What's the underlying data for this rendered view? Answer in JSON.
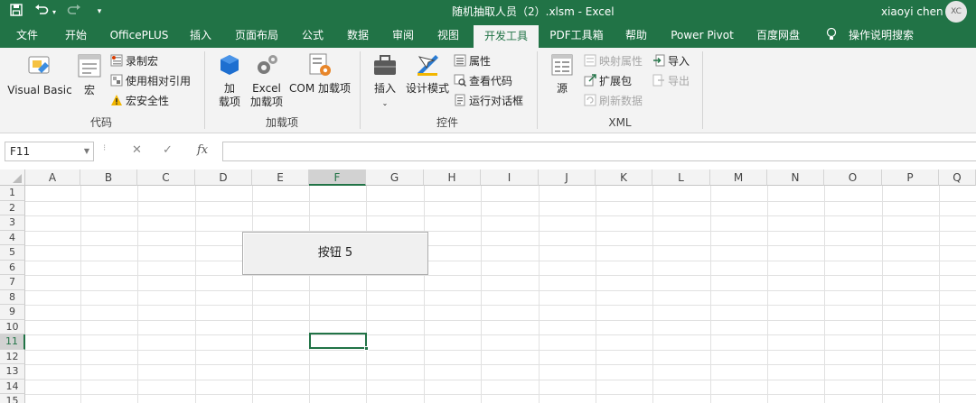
{
  "titlebar": {
    "title": "随机抽取人员（2）.xlsm  -  Excel",
    "user": "xiaoyi chen",
    "avatar_initials": "XC",
    "qat": [
      "save-icon",
      "undo-icon",
      "redo-icon",
      "customize-icon"
    ]
  },
  "tabs": [
    {
      "label": "文件"
    },
    {
      "label": "开始"
    },
    {
      "label": "OfficePLUS"
    },
    {
      "label": "插入"
    },
    {
      "label": "页面布局"
    },
    {
      "label": "公式"
    },
    {
      "label": "数据"
    },
    {
      "label": "审阅"
    },
    {
      "label": "视图"
    },
    {
      "label": "开发工具",
      "active": true
    },
    {
      "label": "PDF工具箱"
    },
    {
      "label": "帮助"
    },
    {
      "label": "Power Pivot"
    },
    {
      "label": "百度网盘"
    },
    {
      "label": "操作说明搜索"
    }
  ],
  "ribbon": {
    "code": {
      "label": "代码",
      "visual_basic": "Visual Basic",
      "macros": "宏",
      "record_macro": "录制宏",
      "relative_refs": "使用相对引用",
      "macro_security": "宏安全性"
    },
    "addins": {
      "label": "加载项",
      "addins_line1": "加",
      "addins_line2": "载项",
      "excel_addins_line1": "Excel",
      "excel_addins_line2": "加载项",
      "com_addins": "COM 加载项"
    },
    "controls": {
      "label": "控件",
      "insert": "插入",
      "design_mode": "设计模式",
      "properties": "属性",
      "view_code": "查看代码",
      "run_dialog": "运行对话框"
    },
    "xml": {
      "label": "XML",
      "source": "源",
      "map_properties": "映射属性",
      "expansion_packs": "扩展包",
      "refresh_data": "刷新数据",
      "import": "导入",
      "export": "导出"
    }
  },
  "formula_bar": {
    "name_box": "F11",
    "cancel": "✕",
    "enter": "✓",
    "fx": "fx",
    "formula": ""
  },
  "sheet": {
    "columns": [
      "A",
      "B",
      "C",
      "D",
      "E",
      "F",
      "G",
      "H",
      "I",
      "J",
      "K",
      "L",
      "M",
      "N",
      "O",
      "P",
      "Q"
    ],
    "rows": [
      "1",
      "2",
      "3",
      "4",
      "5",
      "6",
      "7",
      "8",
      "9",
      "10",
      "11",
      "12",
      "13",
      "14",
      "15"
    ],
    "selected_column": "F",
    "selected_row": "11",
    "button_label": "按钮 5"
  },
  "colors": {
    "accent": "#217346",
    "ribbon_bg": "#f3f3f3"
  }
}
